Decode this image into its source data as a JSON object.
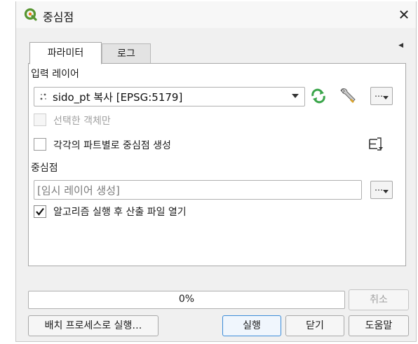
{
  "window": {
    "title": "중심점",
    "close_glyph": "✕",
    "app_icon": "qgis-logo-icon",
    "accent": "#589632"
  },
  "tabs": [
    {
      "label": "파라미터"
    },
    {
      "label": "로그"
    }
  ],
  "form": {
    "input_layer_label": "입력 레이어",
    "input_layer_value": "sido_pt 복사 [EPSG:5179]",
    "selected_only_label": "선택한 객체만",
    "per_part_label": "각각의 파트별로 중심점 생성",
    "output_label": "중심점",
    "output_placeholder": "[임시 레이어 생성]",
    "open_after_label": "알고리즘 실행 후 산출 파일 열기",
    "ellipsis": "…"
  },
  "progress": {
    "value": 0,
    "text": "0%"
  },
  "buttons": {
    "cancel": "취소",
    "batch": "배치 프로세스로 실행…",
    "run": "실행",
    "close": "닫기",
    "help": "도움말"
  }
}
